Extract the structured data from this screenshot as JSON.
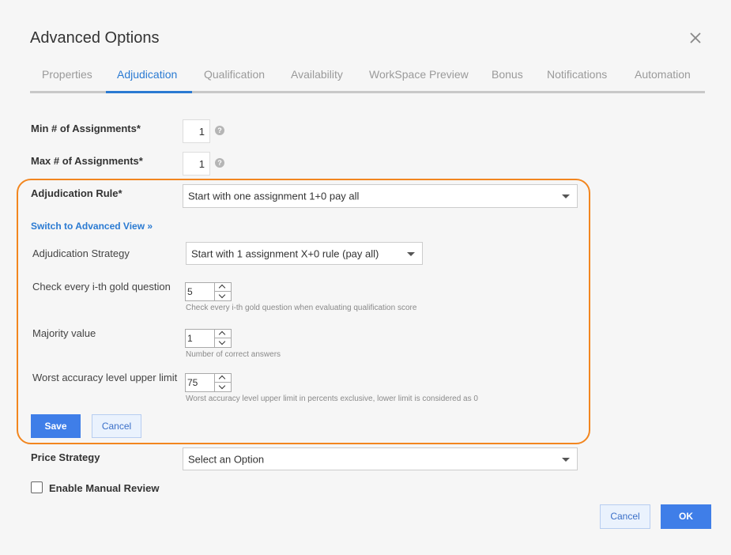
{
  "dialog": {
    "title": "Advanced Options"
  },
  "tabs": [
    {
      "label": "Properties",
      "active": false
    },
    {
      "label": "Adjudication",
      "active": true
    },
    {
      "label": "Qualification",
      "active": false
    },
    {
      "label": "Availability",
      "active": false
    },
    {
      "label": "WorkSpace Preview",
      "active": false
    },
    {
      "label": "Bonus",
      "active": false
    },
    {
      "label": "Notifications",
      "active": false
    },
    {
      "label": "Automation",
      "active": false
    }
  ],
  "form": {
    "min_assignments": {
      "label": "Min # of Assignments*",
      "value": "1"
    },
    "max_assignments": {
      "label": "Max # of Assignments*",
      "value": "1"
    },
    "adjudication_rule": {
      "label": "Adjudication Rule*",
      "value": "Start with one assignment 1+0 pay all"
    },
    "switch_link": "Switch to Advanced View »",
    "adjudication_strategy": {
      "label": "Adjudication Strategy",
      "value": "Start with 1 assignment X+0 rule (pay all)"
    },
    "gold_question": {
      "label": "Check every i-th gold question",
      "value": "5",
      "hint": "Check every i-th gold question when evaluating qualification score"
    },
    "majority_value": {
      "label": "Majority value",
      "value": "1",
      "hint": "Number of correct answers"
    },
    "worst_accuracy": {
      "label": "Worst accuracy level upper limit",
      "value": "75",
      "hint": "Worst accuracy level upper limit in percents exclusive, lower limit is considered as 0"
    },
    "save_label": "Save",
    "cancel_label": "Cancel",
    "price_strategy": {
      "label": "Price Strategy",
      "value": "Select an Option"
    },
    "manual_review": {
      "label": "Enable Manual Review",
      "checked": false
    }
  },
  "footer": {
    "cancel_label": "Cancel",
    "ok_label": "OK"
  },
  "colors": {
    "accent": "#2a7ad2",
    "highlight": "#f2861f",
    "primary_button": "#3f7ee8"
  },
  "icons": {
    "close": "close-icon",
    "help": "question-circle-icon",
    "dropdown": "caret-down-icon",
    "spinner_up": "chevron-up-icon",
    "spinner_down": "chevron-down-icon"
  }
}
